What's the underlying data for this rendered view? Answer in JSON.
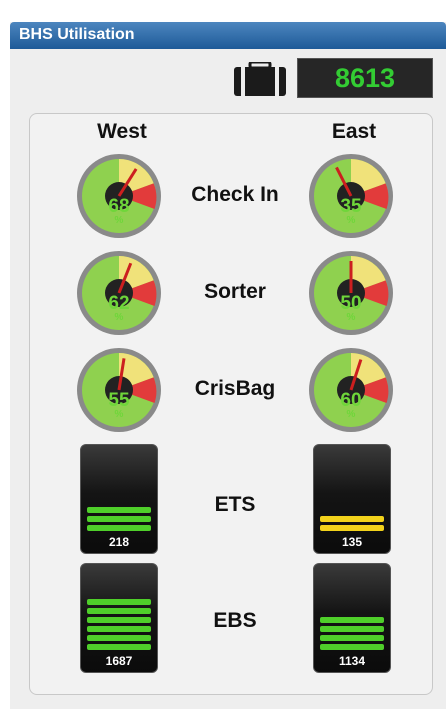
{
  "panel": {
    "title": "BHS Utilisation"
  },
  "total": {
    "icon": "luggage-icon",
    "count": "8613"
  },
  "columns": {
    "west": "West",
    "east": "East"
  },
  "rows": [
    {
      "label": "Check In",
      "west": {
        "value": "68",
        "unit": "%"
      },
      "east": {
        "value": "35",
        "unit": "%"
      }
    },
    {
      "label": "Sorter",
      "west": {
        "value": "62",
        "unit": "%"
      },
      "east": {
        "value": "50",
        "unit": "%"
      }
    },
    {
      "label": "CrisBag",
      "west": {
        "value": "55",
        "unit": "%"
      },
      "east": {
        "value": "60",
        "unit": "%"
      }
    }
  ],
  "levels": [
    {
      "label": "ETS",
      "west": {
        "value": "218",
        "color": "#4fcf2a",
        "fill": 0.35
      },
      "east": {
        "value": "135",
        "color": "#f2d21b",
        "fill": 0.25
      }
    },
    {
      "label": "EBS",
      "west": {
        "value": "1687",
        "color": "#4fcf2a",
        "fill": 0.8
      },
      "east": {
        "value": "1134",
        "color": "#4fcf2a",
        "fill": 0.45
      }
    }
  ],
  "colors": {
    "titlebar": "#2a6aa9",
    "counter_text": "#33cc33",
    "gauge_green": "#8fd14f",
    "gauge_yellow": "#f0e27a",
    "gauge_red": "#e23b3b",
    "needle": "#cc1f1f"
  }
}
